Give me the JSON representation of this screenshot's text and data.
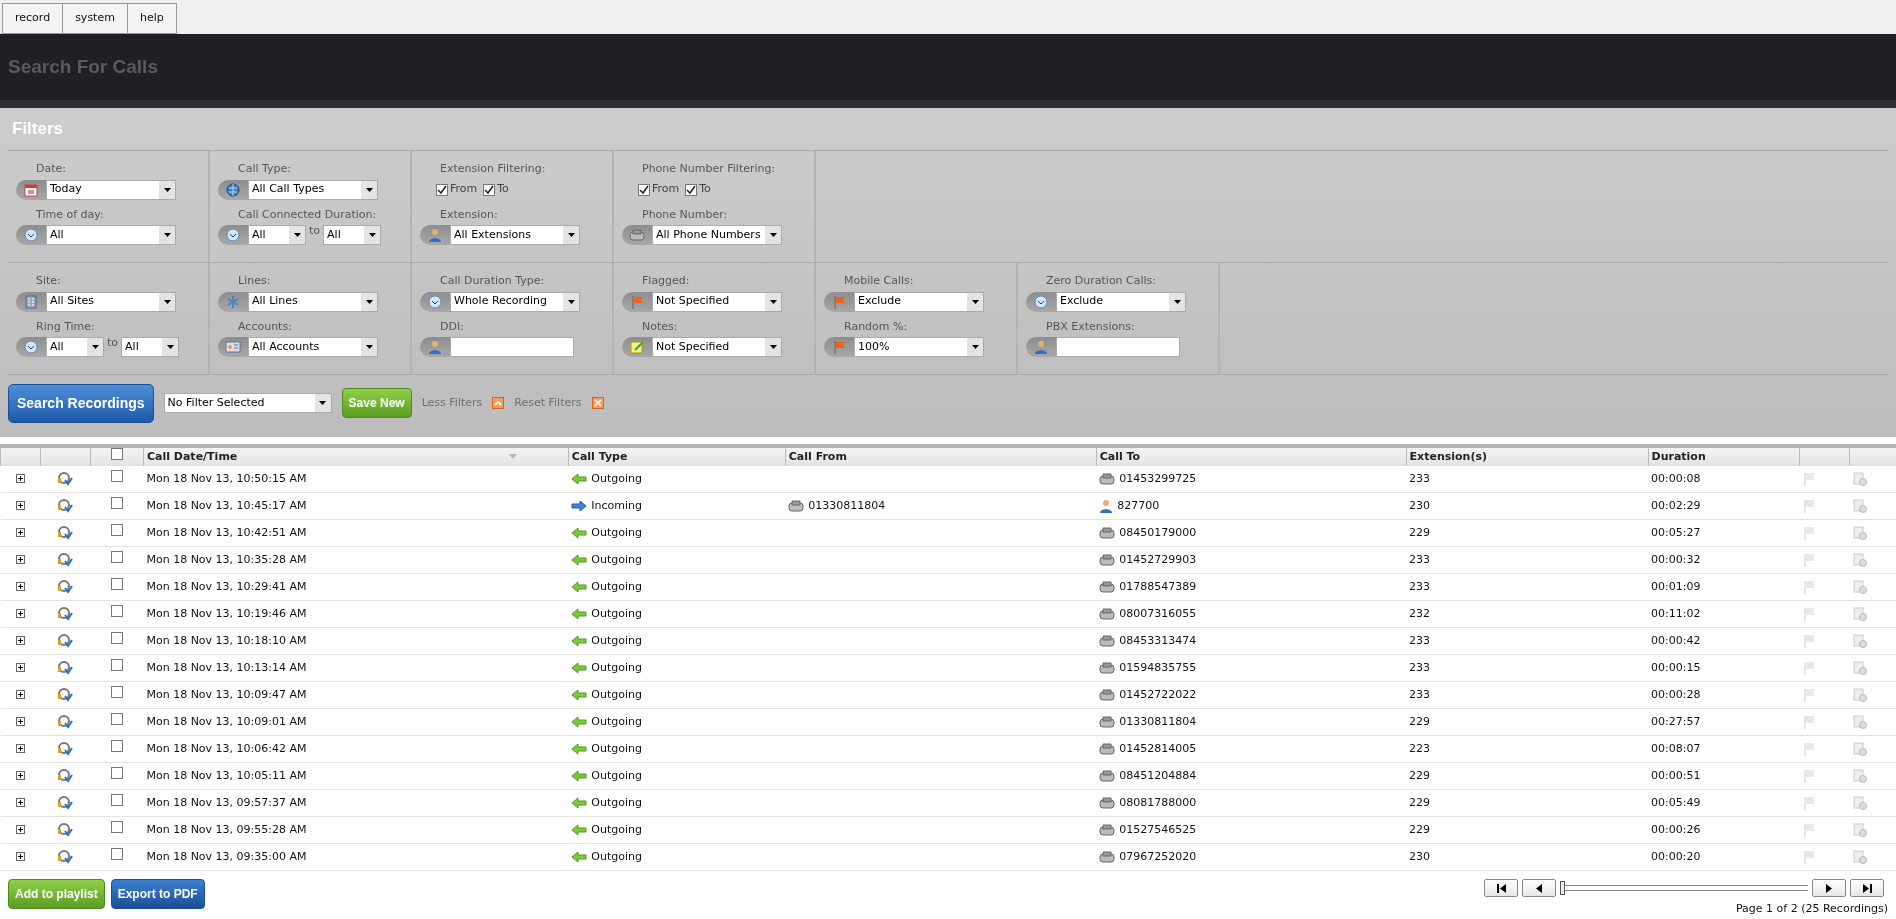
{
  "menu": [
    {
      "label": "record"
    },
    {
      "label": "system"
    },
    {
      "label": "help"
    }
  ],
  "page_title": "Search For Calls",
  "filters": {
    "title": "Filters",
    "rows": [
      [
        {
          "fields": [
            {
              "kind": "select",
              "label": "Date:",
              "value": "Today"
            },
            {
              "kind": "range",
              "label": "Time of day:",
              "value": "All"
            }
          ]
        },
        {
          "fields": [
            {
              "kind": "select",
              "label": "Call Type:",
              "value": "All Call Types"
            },
            {
              "kind": "range",
              "label": "Call Connected Duration:",
              "from": "All",
              "separator": "to",
              "to": "All"
            }
          ]
        },
        {
          "fields": [
            {
              "kind": "checks",
              "label": "Extension Filtering:",
              "options": [
                {
                  "label": "From",
                  "checked": true
                },
                {
                  "label": "To",
                  "checked": true
                }
              ]
            },
            {
              "kind": "select",
              "label": "Extension:",
              "value": "All Extensions"
            }
          ]
        },
        {
          "fields": [
            {
              "kind": "checks",
              "label": "Phone Number Filtering:",
              "options": [
                {
                  "label": "From",
                  "checked": true
                },
                {
                  "label": "To",
                  "checked": true
                }
              ]
            },
            {
              "kind": "select",
              "label": "Phone Number:",
              "value": "All Phone Numbers"
            }
          ]
        }
      ],
      [
        {
          "fields": [
            {
              "kind": "select",
              "label": "Site:",
              "value": "All Sites"
            },
            {
              "kind": "range",
              "label": "Ring Time:",
              "from": "All",
              "separator": "to",
              "to": "All"
            }
          ]
        },
        {
          "fields": [
            {
              "kind": "select",
              "label": "Lines:",
              "value": "All Lines"
            },
            {
              "kind": "select",
              "label": "Accounts:",
              "value": "All Accounts"
            }
          ]
        },
        {
          "fields": [
            {
              "kind": "select",
              "label": "Call Duration Type:",
              "value": "Whole Recording"
            },
            {
              "kind": "text",
              "label": "DDI:"
            }
          ]
        },
        {
          "fields": [
            {
              "kind": "select",
              "label": "Flagged:",
              "value": "Not Specified"
            },
            {
              "kind": "select",
              "label": "Notes:",
              "value": "Not Specified"
            }
          ]
        },
        {
          "fields": [
            {
              "kind": "select",
              "label": "Mobile Calls:",
              "value": "Exclude"
            },
            {
              "kind": "select",
              "label": "Random %:",
              "value": "100%"
            }
          ]
        },
        {
          "fields": [
            {
              "kind": "select",
              "label": "Zero Duration Calls:",
              "value": "Exclude"
            },
            {
              "kind": "text",
              "label": "PBX Extensions:"
            }
          ]
        }
      ]
    ]
  },
  "actions": {
    "search_button": "Search Recordings",
    "saved_filter": "No Filter Selected",
    "save_button": "Save New",
    "less_filters": "Less Filters",
    "reset_filters": "Reset Filters"
  },
  "table": {
    "select_all_checked": false,
    "columns": [
      "Call Date/Time",
      "Call Type",
      "Call From",
      "Call To",
      "Extension(s)",
      "Duration"
    ],
    "rows": [
      {
        "checked": false,
        "date": "Mon 18 Nov 13, 10:50:15 AM",
        "call_type": {
          "kind": "outgoing",
          "label": "Outgoing"
        },
        "call_to": {
          "kind": "phone",
          "number": "01453299725"
        },
        "extension": "233",
        "duration": "00:00:08"
      },
      {
        "checked": false,
        "date": "Mon 18 Nov 13, 10:45:17 AM",
        "call_type": {
          "kind": "incoming",
          "label": "Incoming"
        },
        "call_from": {
          "kind": "phone",
          "number": "01330811804"
        },
        "call_to": {
          "kind": "person",
          "number": "827700"
        },
        "extension": "230",
        "duration": "00:02:29"
      },
      {
        "checked": false,
        "date": "Mon 18 Nov 13, 10:42:51 AM",
        "call_type": {
          "kind": "outgoing",
          "label": "Outgoing"
        },
        "call_to": {
          "kind": "phone",
          "number": "08450179000"
        },
        "extension": "229",
        "duration": "00:05:27"
      },
      {
        "checked": false,
        "date": "Mon 18 Nov 13, 10:35:28 AM",
        "call_type": {
          "kind": "outgoing",
          "label": "Outgoing"
        },
        "call_to": {
          "kind": "phone",
          "number": "01452729903"
        },
        "extension": "233",
        "duration": "00:00:32"
      },
      {
        "checked": false,
        "date": "Mon 18 Nov 13, 10:29:41 AM",
        "call_type": {
          "kind": "outgoing",
          "label": "Outgoing"
        },
        "call_to": {
          "kind": "phone",
          "number": "01788547389"
        },
        "extension": "233",
        "duration": "00:01:09"
      },
      {
        "checked": false,
        "date": "Mon 18 Nov 13, 10:19:46 AM",
        "call_type": {
          "kind": "outgoing",
          "label": "Outgoing"
        },
        "call_to": {
          "kind": "phone",
          "number": "08007316055"
        },
        "extension": "232",
        "duration": "00:11:02"
      },
      {
        "checked": false,
        "date": "Mon 18 Nov 13, 10:18:10 AM",
        "call_type": {
          "kind": "outgoing",
          "label": "Outgoing"
        },
        "call_to": {
          "kind": "phone",
          "number": "08453313474"
        },
        "extension": "233",
        "duration": "00:00:42"
      },
      {
        "checked": false,
        "date": "Mon 18 Nov 13, 10:13:14 AM",
        "call_type": {
          "kind": "outgoing",
          "label": "Outgoing"
        },
        "call_to": {
          "kind": "phone",
          "number": "01594835755"
        },
        "extension": "233",
        "duration": "00:00:15"
      },
      {
        "checked": false,
        "date": "Mon 18 Nov 13, 10:09:47 AM",
        "call_type": {
          "kind": "outgoing",
          "label": "Outgoing"
        },
        "call_to": {
          "kind": "phone",
          "number": "01452722022"
        },
        "extension": "233",
        "duration": "00:00:28"
      },
      {
        "checked": false,
        "date": "Mon 18 Nov 13, 10:09:01 AM",
        "call_type": {
          "kind": "outgoing",
          "label": "Outgoing"
        },
        "call_to": {
          "kind": "phone",
          "number": "01330811804"
        },
        "extension": "229",
        "duration": "00:27:57"
      },
      {
        "checked": false,
        "date": "Mon 18 Nov 13, 10:06:42 AM",
        "call_type": {
          "kind": "outgoing",
          "label": "Outgoing"
        },
        "call_to": {
          "kind": "phone",
          "number": "01452814005"
        },
        "extension": "223",
        "duration": "00:08:07"
      },
      {
        "checked": false,
        "date": "Mon 18 Nov 13, 10:05:11 AM",
        "call_type": {
          "kind": "outgoing",
          "label": "Outgoing"
        },
        "call_to": {
          "kind": "phone",
          "number": "08451204884"
        },
        "extension": "229",
        "duration": "00:00:51"
      },
      {
        "checked": false,
        "date": "Mon 18 Nov 13, 09:57:37 AM",
        "call_type": {
          "kind": "outgoing",
          "label": "Outgoing"
        },
        "call_to": {
          "kind": "phone",
          "number": "08081788000"
        },
        "extension": "229",
        "duration": "00:05:49"
      },
      {
        "checked": false,
        "date": "Mon 18 Nov 13, 09:55:28 AM",
        "call_type": {
          "kind": "outgoing",
          "label": "Outgoing"
        },
        "call_to": {
          "kind": "phone",
          "number": "01527546525"
        },
        "extension": "229",
        "duration": "00:00:26"
      },
      {
        "checked": false,
        "date": "Mon 18 Nov 13, 09:35:00 AM",
        "call_type": {
          "kind": "outgoing",
          "label": "Outgoing"
        },
        "call_to": {
          "kind": "phone",
          "number": "07967252020"
        },
        "extension": "230",
        "duration": "00:00:20"
      }
    ]
  },
  "footer": {
    "buttons": [
      {
        "label": "Add to playlist",
        "kind": "green"
      },
      {
        "label": "Export to PDF",
        "kind": "blue"
      }
    ],
    "pager": {
      "level": 0
    },
    "page_info": "Page 1 of 2 (25 Recordings)"
  }
}
